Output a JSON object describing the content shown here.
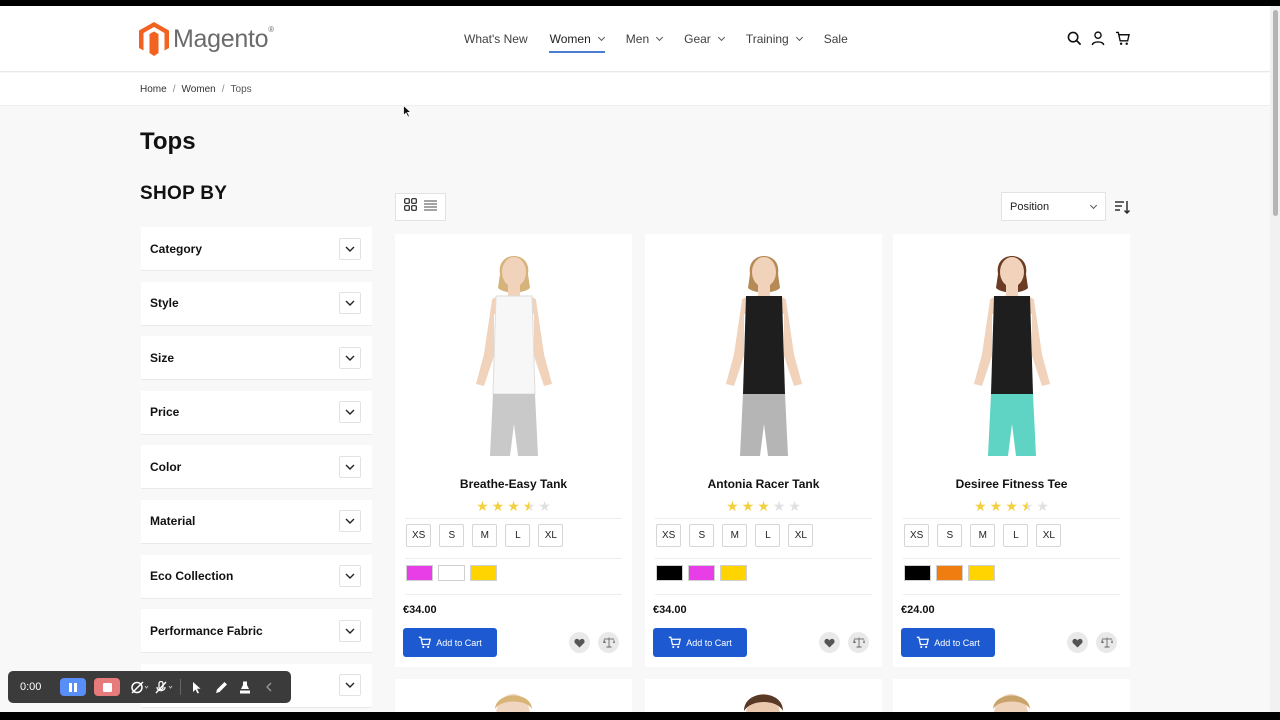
{
  "header": {
    "logo_text": "Magento",
    "logo_mark": "®",
    "nav": [
      {
        "label": "What's New",
        "active": false,
        "dropdown": false
      },
      {
        "label": "Women",
        "active": true,
        "dropdown": true
      },
      {
        "label": "Men",
        "active": false,
        "dropdown": true
      },
      {
        "label": "Gear",
        "active": false,
        "dropdown": true
      },
      {
        "label": "Training",
        "active": false,
        "dropdown": true
      },
      {
        "label": "Sale",
        "active": false,
        "dropdown": false
      }
    ],
    "icons": [
      "search-icon",
      "account-icon",
      "cart-icon"
    ]
  },
  "breadcrumb": [
    "Home",
    "Women",
    "Tops"
  ],
  "page_title": "Tops",
  "sidebar": {
    "title": "SHOP BY",
    "filters": [
      "Category",
      "Style",
      "Size",
      "Price",
      "Color",
      "Material",
      "Eco Collection",
      "Performance Fabric",
      ""
    ]
  },
  "toolbar": {
    "sort_value": "Position"
  },
  "products": [
    {
      "name": "Breathe-Easy Tank",
      "rating": 3.5,
      "sizes": [
        "XS",
        "S",
        "M",
        "L",
        "XL"
      ],
      "swatches": [
        "#e83ee8",
        "#ffffff",
        "#ffd400"
      ],
      "price": "€34.00",
      "add_label": "Add to Cart",
      "top": "#f7f7f7",
      "bottom": "#c9c9c9"
    },
    {
      "name": "Antonia Racer Tank",
      "rating": 3,
      "sizes": [
        "XS",
        "S",
        "M",
        "L",
        "XL"
      ],
      "swatches": [
        "#000000",
        "#e83ee8",
        "#ffd400"
      ],
      "price": "€34.00",
      "add_label": "Add to Cart",
      "top": "#1e1e1e",
      "bottom": "#b5b5b5"
    },
    {
      "name": "Desiree Fitness Tee",
      "rating": 3.5,
      "sizes": [
        "XS",
        "S",
        "M",
        "L",
        "XL"
      ],
      "swatches": [
        "#000000",
        "#ef7d0f",
        "#ffd400"
      ],
      "price": "€24.00",
      "add_label": "Add to Cart",
      "top": "#1e1e1e",
      "bottom": "#5fd4c4"
    }
  ],
  "recorder": {
    "time": "0:00"
  },
  "colors": {
    "accent": "#1d5ad1",
    "nav_underline": "#4a7cd3",
    "star": "#f4d03f",
    "star_empty": "#e0e0e0",
    "logo": "#f26322"
  }
}
